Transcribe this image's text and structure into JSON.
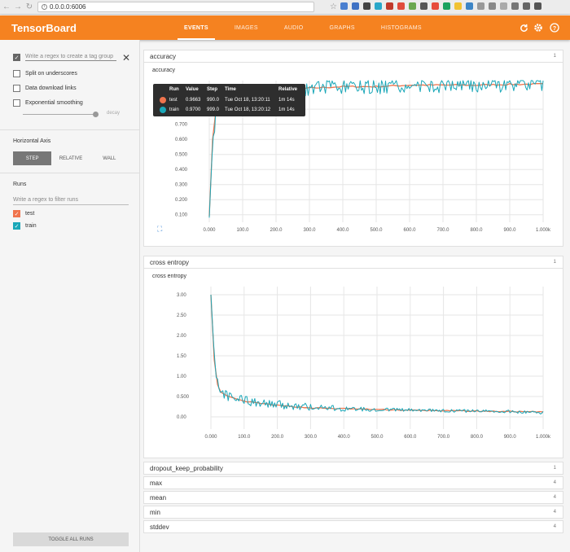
{
  "browser": {
    "url": "0.0.0.0:6006"
  },
  "header": {
    "title": "TensorBoard",
    "tabs": [
      {
        "label": "EVENTS",
        "active": true
      },
      {
        "label": "IMAGES",
        "active": false
      },
      {
        "label": "AUDIO",
        "active": false
      },
      {
        "label": "GRAPHS",
        "active": false
      },
      {
        "label": "HISTOGRAMS",
        "active": false
      }
    ],
    "icons": [
      "refresh-icon",
      "settings-icon",
      "help-icon"
    ]
  },
  "sidebar": {
    "tag_group_placeholder": "Write a regex to create a tag group",
    "split_on_underscores": "Split on underscores",
    "data_download_links": "Data download links",
    "exponential_smoothing": "Exponential smoothing",
    "decay_label": "decay",
    "horizontal_axis_title": "Horizontal Axis",
    "axis_options": [
      "STEP",
      "RELATIVE",
      "WALL"
    ],
    "runs_title": "Runs",
    "runs_filter_placeholder": "Write a regex to filter runs",
    "runs": [
      {
        "name": "test",
        "color": "#f0744d"
      },
      {
        "name": "train",
        "color": "#1aa7b8"
      }
    ],
    "toggle_all_runs": "TOGGLE ALL RUNS"
  },
  "cards": {
    "accuracy": {
      "header": "accuracy",
      "count": "1",
      "chart_title": "accuracy"
    },
    "cross_entropy": {
      "header": "cross entropy",
      "count": "1",
      "chart_title": "cross entropy"
    },
    "dropout": {
      "header": "dropout_keep_probability",
      "count": "1"
    },
    "max": {
      "header": "max",
      "count": "4"
    },
    "mean": {
      "header": "mean",
      "count": "4"
    },
    "min": {
      "header": "min",
      "count": "4"
    },
    "stddev": {
      "header": "stddev",
      "count": "4"
    }
  },
  "tooltip": {
    "headers": {
      "run": "Run",
      "value": "Value",
      "step": "Step",
      "time": "Time",
      "relative": "Relative"
    },
    "rows": [
      {
        "run": "test",
        "value": "0.9663",
        "step": "990.0",
        "time": "Tue Oct 18, 13:20:11",
        "relative": "1m 14s",
        "color": "#f0744d"
      },
      {
        "run": "train",
        "value": "0.9700",
        "step": "999.0",
        "time": "Tue Oct 18, 13:20:12",
        "relative": "1m 14s",
        "color": "#1aa7b8"
      }
    ]
  },
  "chart_data": [
    {
      "type": "line",
      "title": "accuracy",
      "xlim": [
        0,
        1000
      ],
      "ylim": [
        0.05,
        0.99
      ],
      "x_ticks": [
        "0.000",
        "100.0",
        "200.0",
        "300.0",
        "400.0",
        "500.0",
        "600.0",
        "700.0",
        "800.0",
        "900.0",
        "1.000k"
      ],
      "y_ticks": [
        "0.100",
        "0.200",
        "0.300",
        "0.400",
        "0.500",
        "0.600",
        "0.700",
        "0.800"
      ],
      "y_tick_values": [
        0.1,
        0.2,
        0.3,
        0.4,
        0.5,
        0.6,
        0.7,
        0.8
      ],
      "grid": true,
      "series": [
        {
          "name": "test",
          "color": "#f0744d",
          "x": [
            0,
            10,
            20,
            30,
            50,
            100,
            200,
            300,
            400,
            500,
            600,
            700,
            800,
            900,
            990
          ],
          "y": [
            0.09,
            0.6,
            0.8,
            0.86,
            0.89,
            0.91,
            0.93,
            0.94,
            0.95,
            0.95,
            0.96,
            0.96,
            0.96,
            0.965,
            0.9663
          ]
        },
        {
          "name": "train",
          "color": "#1aa7b8",
          "x": [
            0,
            10,
            20,
            30,
            50,
            100,
            200,
            300,
            400,
            500,
            600,
            700,
            800,
            900,
            999
          ],
          "y": [
            0.08,
            0.58,
            0.78,
            0.84,
            0.88,
            0.9,
            0.92,
            0.94,
            0.94,
            0.95,
            0.95,
            0.96,
            0.96,
            0.96,
            0.97
          ]
        }
      ]
    },
    {
      "type": "line",
      "title": "cross entropy",
      "xlim": [
        0,
        1000
      ],
      "ylim": [
        -0.3,
        3.2
      ],
      "x_ticks": [
        "0.000",
        "100.0",
        "200.0",
        "300.0",
        "400.0",
        "500.0",
        "600.0",
        "700.0",
        "800.0",
        "900.0",
        "1.000k"
      ],
      "y_ticks": [
        "0.00",
        "0.500",
        "1.00",
        "1.50",
        "2.00",
        "2.50",
        "3.00"
      ],
      "y_tick_values": [
        0,
        0.5,
        1.0,
        1.5,
        2.0,
        2.5,
        3.0
      ],
      "grid": true,
      "series": [
        {
          "name": "test",
          "color": "#f0744d",
          "x": [
            0,
            10,
            20,
            30,
            50,
            100,
            200,
            300,
            400,
            500,
            600,
            700,
            800,
            900,
            990
          ],
          "y": [
            3.0,
            1.4,
            0.8,
            0.6,
            0.5,
            0.38,
            0.28,
            0.22,
            0.2,
            0.18,
            0.16,
            0.15,
            0.14,
            0.13,
            0.12
          ]
        },
        {
          "name": "train",
          "color": "#1aa7b8",
          "x": [
            0,
            10,
            20,
            30,
            50,
            100,
            200,
            300,
            400,
            500,
            600,
            700,
            800,
            900,
            999
          ],
          "y": [
            3.0,
            1.5,
            0.85,
            0.65,
            0.5,
            0.4,
            0.3,
            0.24,
            0.2,
            0.18,
            0.17,
            0.15,
            0.14,
            0.13,
            0.1
          ]
        }
      ]
    }
  ]
}
